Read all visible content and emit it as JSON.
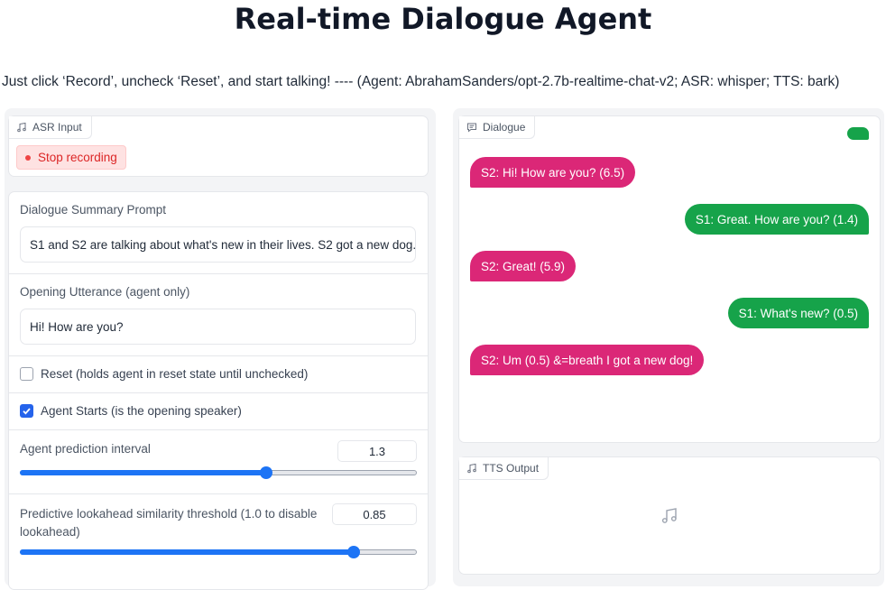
{
  "page": {
    "title": "Real-time Dialogue Agent",
    "subtitle": "Just click ‘Record’, uncheck ‘Reset’, and start talking! ---- (Agent: AbrahamSanders/opt-2.7b-realtime-chat-v2; ASR: whisper; TTS: bark)"
  },
  "asr": {
    "label": "ASR Input",
    "icon": "music-note-icon",
    "record_button": "Stop recording"
  },
  "settings": {
    "summary_label": "Dialogue Summary Prompt",
    "summary_value": "S1 and S2 are talking about what's new in their lives. S2 got a new dog.",
    "opening_label": "Opening Utterance (agent only)",
    "opening_value": "Hi! How are you?",
    "reset_label": "Reset (holds agent in reset state until unchecked)",
    "reset_checked": false,
    "agent_starts_label": "Agent Starts (is the opening speaker)",
    "agent_starts_checked": true,
    "interval_label": "Agent prediction interval",
    "interval_value": "1.3",
    "interval_fraction": 0.62,
    "lookahead_label_1": "Predictive lookahead similarity threshold (1.0 to disable",
    "lookahead_label_2": "lookahead)",
    "lookahead_value": "0.85",
    "lookahead_fraction": 0.84
  },
  "dialogue": {
    "label": "Dialogue",
    "icon": "chat-icon",
    "messages": [
      {
        "speaker": "bot",
        "text": "S2: Hi! How are you? (6.5)"
      },
      {
        "speaker": "user",
        "text": "S1: Great. How are you? (1.4)"
      },
      {
        "speaker": "bot",
        "text": "S2: Great! (5.9)"
      },
      {
        "speaker": "user",
        "text": "S1: What's new? (0.5)"
      },
      {
        "speaker": "bot",
        "text": "S2: Um (0.5) &=breath I got a new dog!"
      }
    ],
    "bot_color": "#db2777",
    "user_color": "#16a34a"
  },
  "tts": {
    "label": "TTS Output",
    "icon": "music-note-icon"
  }
}
